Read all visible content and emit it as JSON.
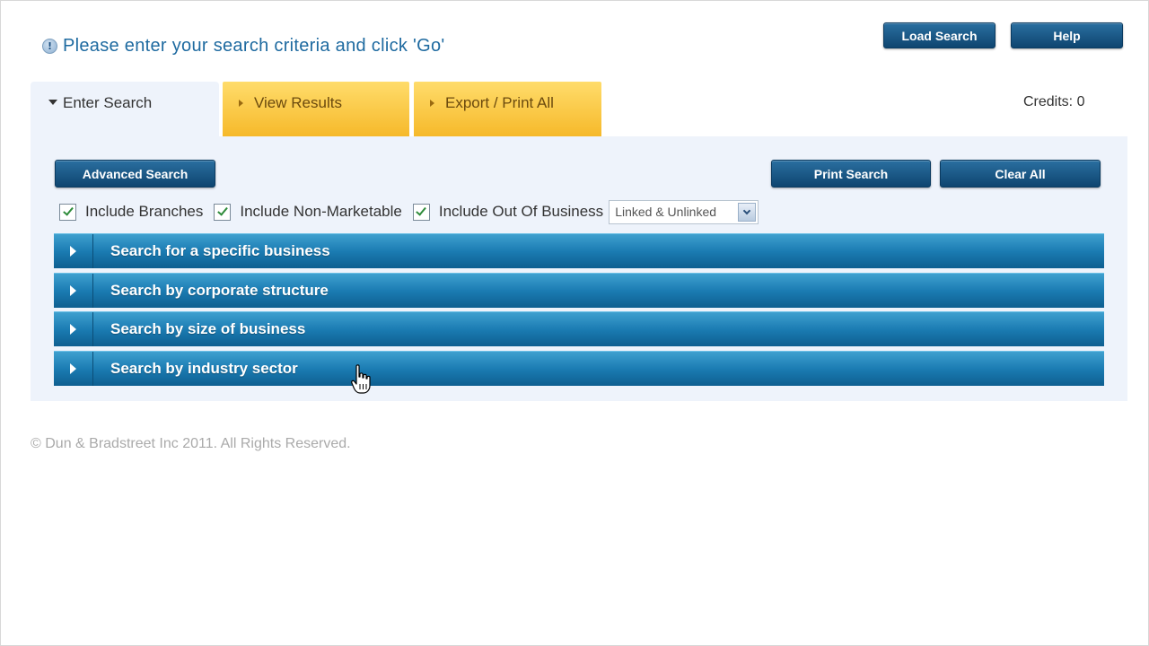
{
  "header": {
    "info_icon": "info-circle-icon",
    "instruction": "Please enter your search criteria and click 'Go'",
    "load_search_label": "Load Search",
    "help_label": "Help"
  },
  "tabs": [
    {
      "label": "Enter Search",
      "active": true
    },
    {
      "label": "View Results",
      "active": false
    },
    {
      "label": "Export / Print All",
      "active": false
    }
  ],
  "credits": "Credits: 0",
  "toolbar": {
    "advanced_search_label": "Advanced Search",
    "print_search_label": "Print Search",
    "clear_all_label": "Clear All"
  },
  "options": {
    "checkboxes": [
      {
        "label": "Include Branches",
        "checked": true
      },
      {
        "label": "Include Non-Marketable",
        "checked": true
      },
      {
        "label": "Include Out Of Business",
        "checked": true
      }
    ],
    "link_select": {
      "selected": "Linked & Unlinked"
    }
  },
  "sections": [
    {
      "label": "Search for a specific business"
    },
    {
      "label": "Search by corporate structure"
    },
    {
      "label": "Search by size of business"
    },
    {
      "label": "Search by industry sector"
    }
  ],
  "footer": "© Dun & Bradstreet Inc 2011. All Rights Reserved.",
  "colors": {
    "accent_blue": "#1b7cb3",
    "tab_yellow": "#f6b92a",
    "panel_bg": "#eef3fb",
    "instruction_blue": "#1e6aa0"
  }
}
